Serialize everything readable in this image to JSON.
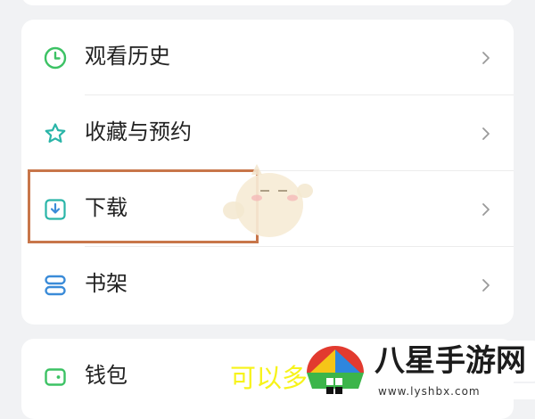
{
  "menu": {
    "items": [
      {
        "label": "观看历史",
        "icon": "clock-icon"
      },
      {
        "label": "收藏与预约",
        "icon": "star-icon"
      },
      {
        "label": "下载",
        "icon": "download-icon"
      },
      {
        "label": "书架",
        "icon": "bookshelf-icon"
      }
    ]
  },
  "secondary": {
    "items": [
      {
        "label": "钱包",
        "icon": "wallet-icon"
      }
    ]
  },
  "overlay": {
    "caption": "可以多"
  },
  "watermark": {
    "title": "八星手游网",
    "url": "www.lyshbx.com"
  },
  "colors": {
    "icon_green": "#3cc264",
    "icon_teal": "#2ab5a8",
    "icon_blue": "#3a8bd8",
    "highlight": "#c8764a",
    "caption_yellow": "#f7f31a"
  }
}
